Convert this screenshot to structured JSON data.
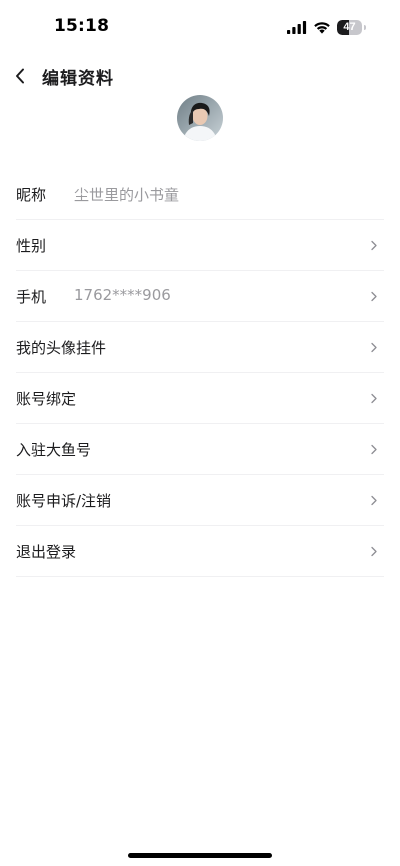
{
  "status_bar": {
    "time": "15:18",
    "battery_percent": "47",
    "battery_level": 0.47,
    "icons": [
      "signal-icon",
      "wifi-icon",
      "battery-icon"
    ]
  },
  "nav": {
    "title": "编辑资料",
    "back_icon": "chevron-left-icon"
  },
  "profile": {
    "avatar_icon": "avatar"
  },
  "settings": {
    "rows": [
      {
        "label": "昵称",
        "value": "尘世里的小书童",
        "chevron": false
      },
      {
        "label": "性别",
        "value": "",
        "chevron": true
      },
      {
        "label": "手机",
        "value": "1762****906",
        "chevron": true
      },
      {
        "label": "我的头像挂件",
        "value": "",
        "chevron": true
      },
      {
        "label": "账号绑定",
        "value": "",
        "chevron": true
      },
      {
        "label": "入驻大鱼号",
        "value": "",
        "chevron": true
      },
      {
        "label": "账号申诉/注销",
        "value": "",
        "chevron": true
      },
      {
        "label": "退出登录",
        "value": "",
        "chevron": true
      }
    ]
  },
  "colors": {
    "background": "#ffffff",
    "text_primary": "#1c1c1e",
    "text_secondary": "#9a9a9e",
    "divider": "#f0f0f2",
    "chevron": "#8e8e93"
  }
}
